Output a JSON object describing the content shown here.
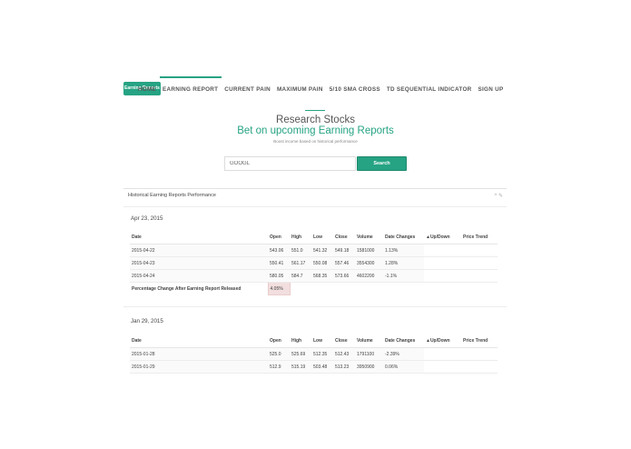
{
  "nav": {
    "logo": "Earning Reports",
    "items": [
      "HOME",
      "EARNING REPORT",
      "CURRENT PAIN",
      "MAXIMUM PAIN",
      "5/10 SMA CROSS",
      "TD SEQUENTIAL INDICATOR",
      "SIGN UP"
    ],
    "active": "EARNING REPORT"
  },
  "hero": {
    "title": "Research Stocks",
    "subtitle": "Bet on upcoming Earning Reports",
    "tagline": "Boost income based on historical performance"
  },
  "search": {
    "value": "GOOGL",
    "button": "Search"
  },
  "panel": {
    "title": "Historical Earning Reports Performance",
    "controls": "^ ✎",
    "columns": [
      "Date",
      "Open",
      "High",
      "Low",
      "Close",
      "Volume",
      "Date Changes",
      "▲Up/Down",
      "Price Trend"
    ],
    "sections": [
      {
        "date": "Apr 23, 2015",
        "rows": [
          [
            "2015-04-22",
            "543.06",
            "551.0",
            "541.32",
            "549.18",
            "1581000",
            "1.13%"
          ],
          [
            "2015-04-23",
            "550.41",
            "561.17",
            "550.08",
            "557.46",
            "3554300",
            "1.28%"
          ],
          [
            "2015-04-24",
            "580.05",
            "584.7",
            "568.35",
            "573.66",
            "4602200",
            "-1.1%"
          ]
        ],
        "summary_label": "Percentage Change After Earning Report Released",
        "summary_value": "4.05%"
      },
      {
        "date": "Jan 29, 2015",
        "rows": [
          [
            "2015-01-28",
            "525.0",
            "525.69",
            "512.35",
            "512.43",
            "1791100",
            "-2.39%"
          ],
          [
            "2015-01-29",
            "512.9",
            "515.19",
            "503.48",
            "513.23",
            "3950900",
            "0.06%"
          ]
        ]
      }
    ]
  }
}
